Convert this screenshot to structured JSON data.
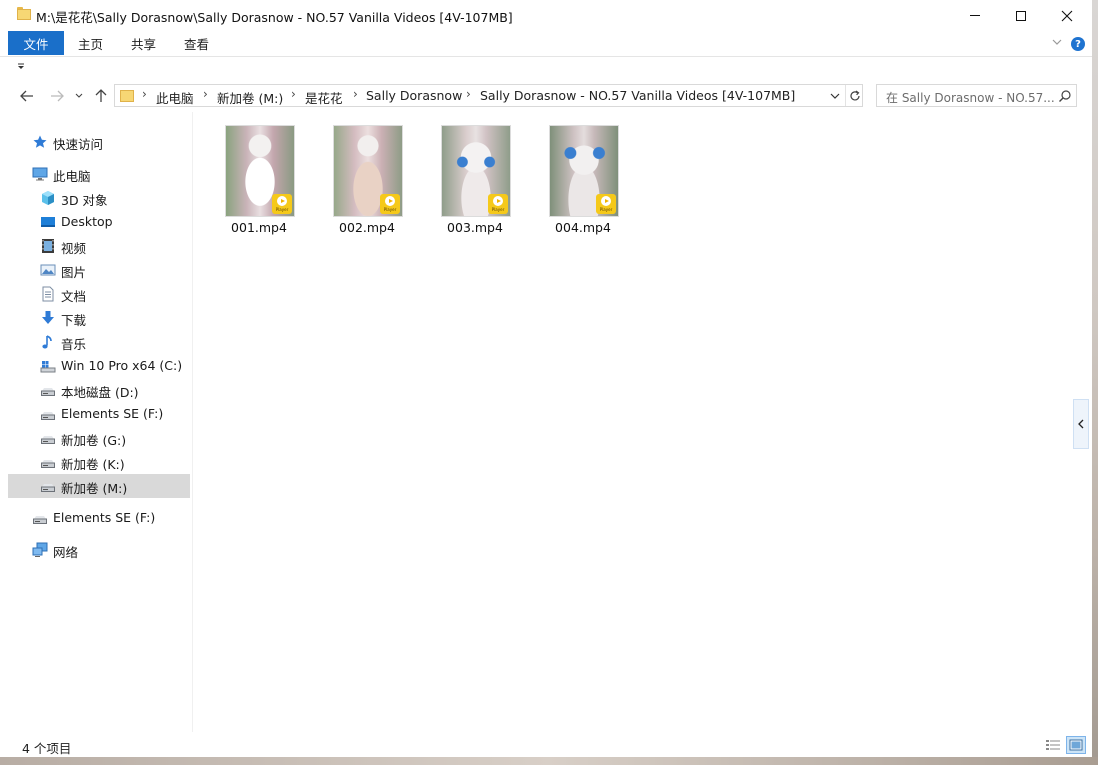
{
  "window": {
    "title": "M:\\是花花\\Sally Dorasnow\\Sally Dorasnow - NO.57 Vanilla Videos [4V-107MB]"
  },
  "ribbon": {
    "file": "文件",
    "home": "主页",
    "share": "共享",
    "view": "查看"
  },
  "address": {
    "crumbs": [
      "此电脑",
      "新加卷 (M:)",
      "是花花",
      "Sally Dorasnow",
      "Sally Dorasnow - NO.57 Vanilla Videos [4V-107MB]"
    ]
  },
  "search": {
    "placeholder": "在 Sally Dorasnow - NO.57..."
  },
  "sidebar": {
    "items": [
      {
        "label": "快速访问",
        "icon": "star-icon"
      },
      {
        "label": "此电脑",
        "icon": "computer-icon"
      },
      {
        "label": "3D 对象",
        "icon": "cube-icon"
      },
      {
        "label": "Desktop",
        "icon": "desktop-icon"
      },
      {
        "label": "视频",
        "icon": "video-icon"
      },
      {
        "label": "图片",
        "icon": "picture-icon"
      },
      {
        "label": "文档",
        "icon": "document-icon"
      },
      {
        "label": "下载",
        "icon": "download-icon"
      },
      {
        "label": "音乐",
        "icon": "music-icon"
      },
      {
        "label": "Win 10 Pro x64 (C:)",
        "icon": "system-drive-icon"
      },
      {
        "label": "本地磁盘 (D:)",
        "icon": "drive-icon"
      },
      {
        "label": "Elements SE (F:)",
        "icon": "drive-icon"
      },
      {
        "label": "新加卷 (G:)",
        "icon": "drive-icon"
      },
      {
        "label": "新加卷 (K:)",
        "icon": "drive-icon"
      },
      {
        "label": "新加卷 (M:)",
        "icon": "drive-icon"
      },
      {
        "label": "Elements SE (F:)",
        "icon": "drive-icon"
      },
      {
        "label": "网络",
        "icon": "network-icon"
      }
    ]
  },
  "files": [
    {
      "name": "001.mp4",
      "badge": "Player"
    },
    {
      "name": "002.mp4",
      "badge": "Player"
    },
    {
      "name": "003.mp4",
      "badge": "Player"
    },
    {
      "name": "004.mp4",
      "badge": "Player"
    }
  ],
  "status": {
    "count": "4 个项目"
  },
  "colors": {
    "accent": "#1a6fc9",
    "selection": "#d9d9d9",
    "folder": "#f7d774"
  }
}
